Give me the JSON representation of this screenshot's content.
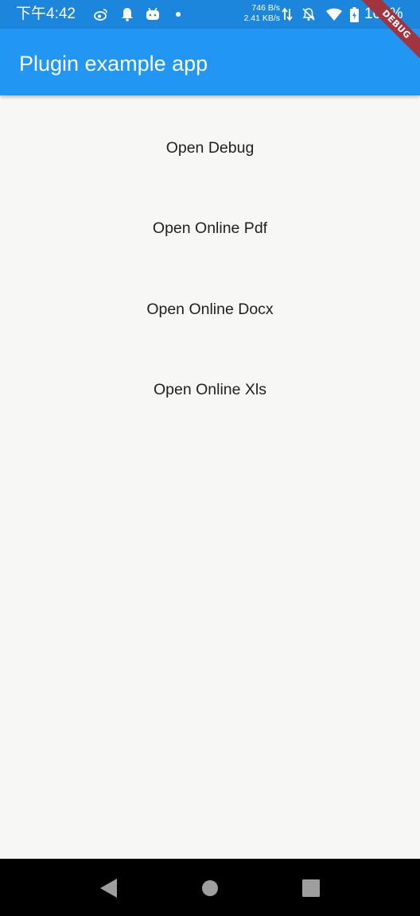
{
  "status_bar": {
    "time": "下午4:42",
    "upload_speed": "746 B/s",
    "download_speed": "2.41 KB/s",
    "battery": "100%",
    "icons": [
      "weibo-icon",
      "notification-bell-icon",
      "app-notification-icon",
      "dot-icon",
      "data-transfer-icon",
      "do-not-disturb-icon",
      "wifi-icon",
      "battery-charging-icon"
    ]
  },
  "app_bar": {
    "title": "Plugin example app"
  },
  "debug_banner": {
    "label": "DEBUG"
  },
  "buttons": [
    {
      "label": "Open Debug"
    },
    {
      "label": "Open Online Pdf"
    },
    {
      "label": "Open Online Docx"
    },
    {
      "label": "Open Online Xls"
    }
  ],
  "nav_bar": {
    "buttons": [
      "back-icon",
      "home-icon",
      "recents-icon"
    ]
  },
  "colors": {
    "status_bar": "#1c86dd",
    "app_bar": "#2196f3",
    "background": "#f7f8f5",
    "debug_ribbon": "#a0343f",
    "nav_bar": "#000000"
  }
}
